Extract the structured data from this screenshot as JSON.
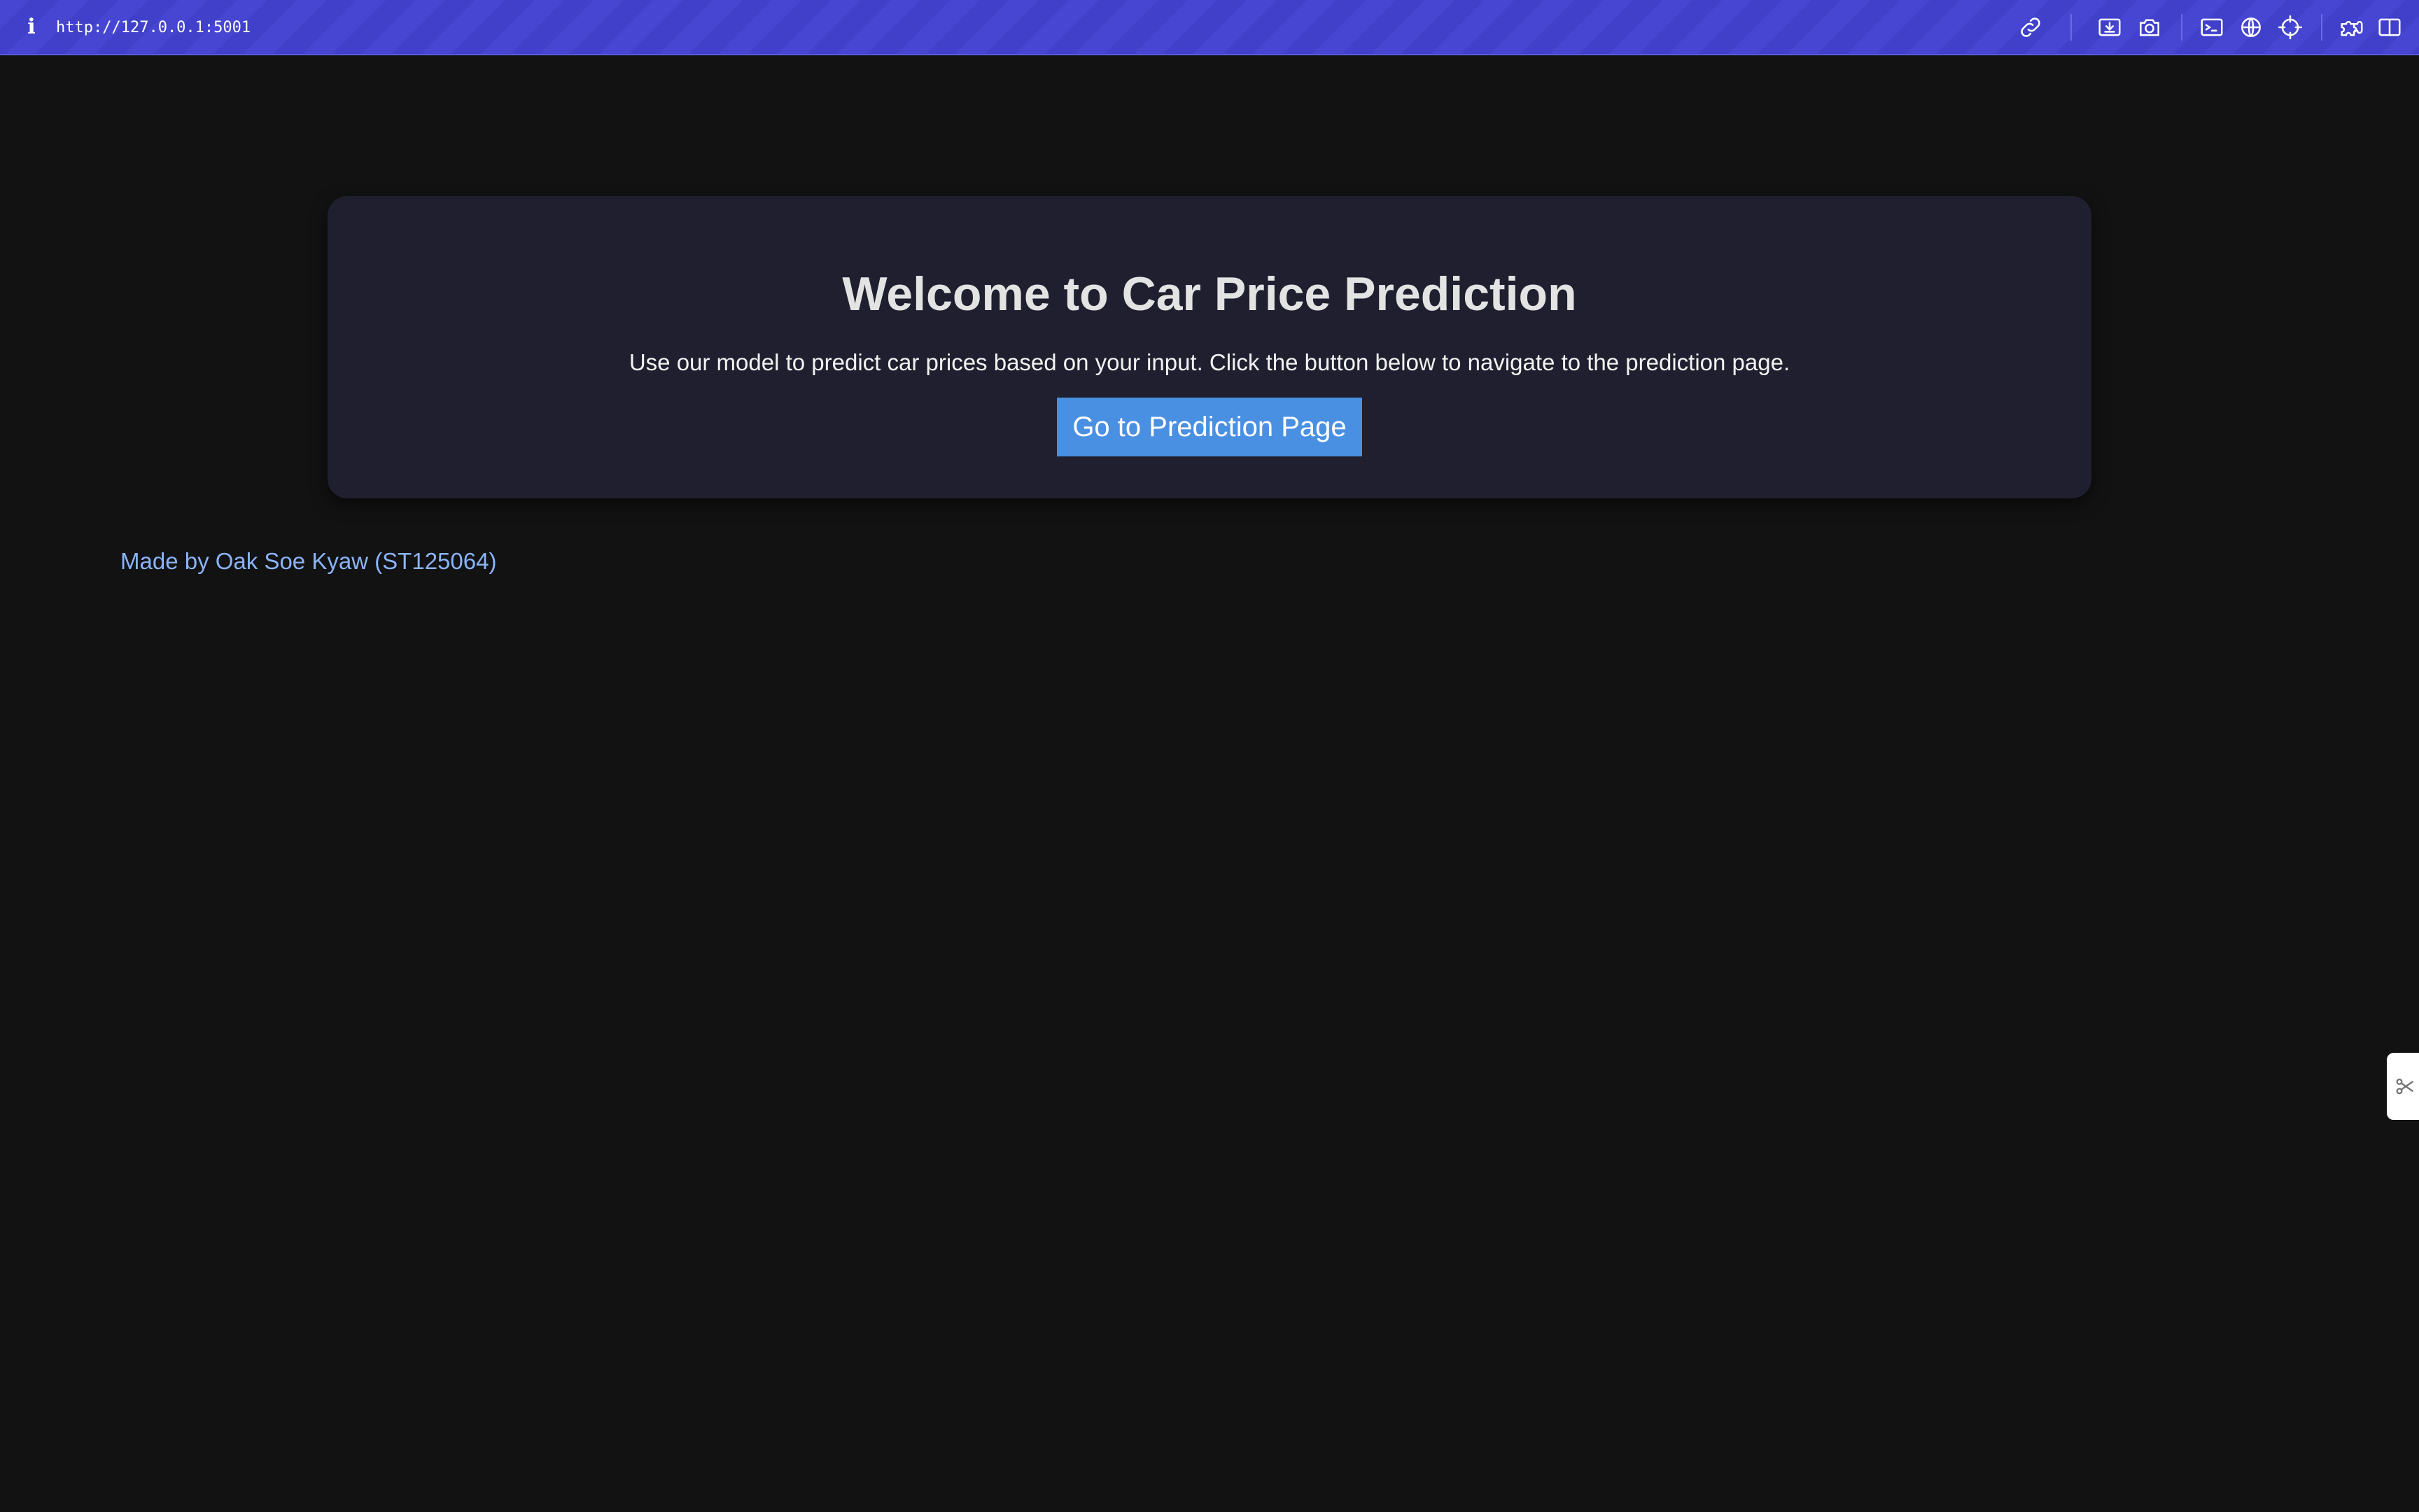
{
  "browser": {
    "url": "http://127.0.0.1:5001",
    "accent_color": "#4646d2",
    "toolbar_icons": [
      "info-icon",
      "link-icon",
      "save-to-device-icon",
      "camera-icon",
      "terminal-icon",
      "globe-icon",
      "crosshair-icon",
      "extension-icon",
      "split-view-icon"
    ]
  },
  "card": {
    "title": "Welcome to Car Price Prediction",
    "description": "Use our model to predict car prices based on your input. Click the button below to navigate to the prediction page.",
    "button_label": "Go to Prediction Page",
    "button_color": "#4a90e2"
  },
  "footer": {
    "credit": "Made by Oak Soe Kyaw (ST125064)"
  },
  "side_widget": {
    "icon": "scissors-icon"
  }
}
